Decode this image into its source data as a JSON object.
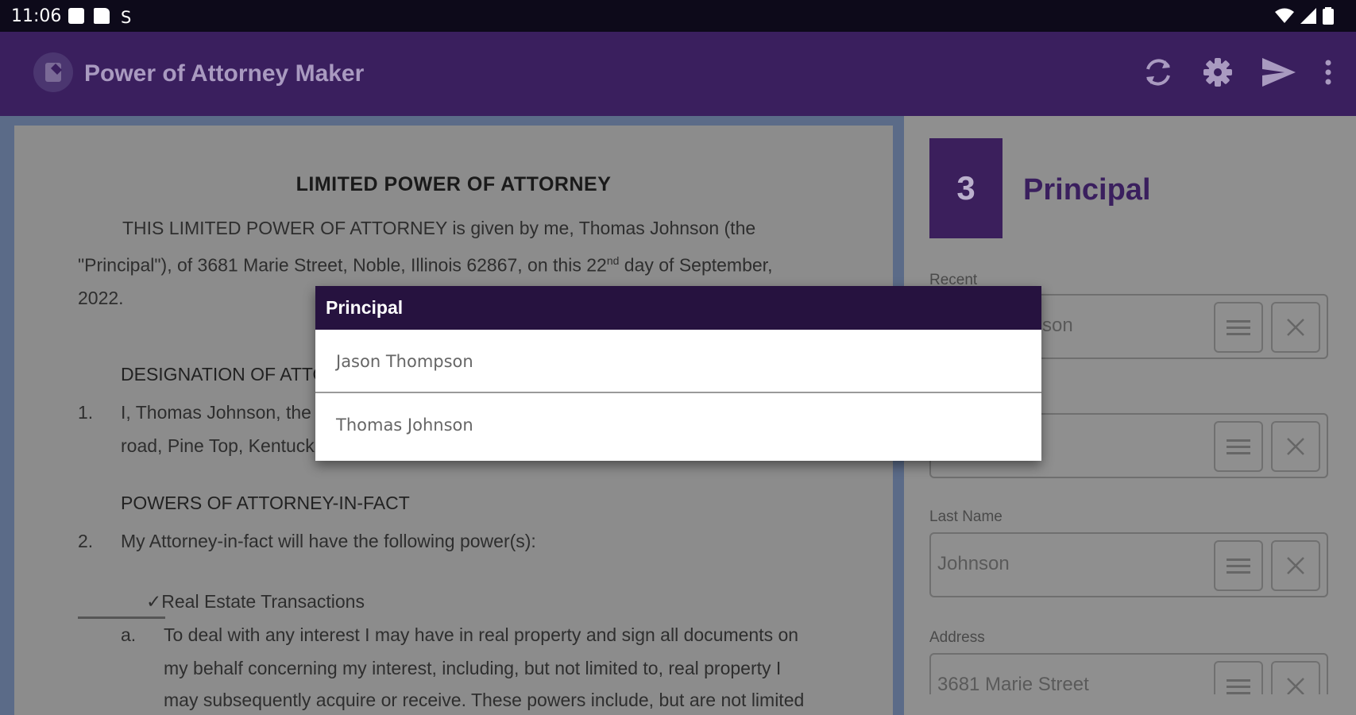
{
  "status_bar": {
    "time": "11:06"
  },
  "app_bar": {
    "title": "Power of Attorney Maker",
    "actions": [
      "sync-icon",
      "gear-icon",
      "send-icon",
      "more-vert-icon"
    ]
  },
  "document": {
    "title": "LIMITED POWER OF ATTORNEY",
    "intro_line1": "THIS LIMITED POWER OF ATTORNEY is given by me, Thomas Johnson (the",
    "intro_line2_a": "\"Principal\"), of 3681 Marie Street, Noble, Illinois 62867, on this 22",
    "intro_line2_sup": "nd",
    "intro_line2_b": " day of September,",
    "intro_line3": "2022.",
    "section1_heading": "DESIGNATION OF ATTO",
    "item1_num": "1.",
    "item1_line1": "I, Thomas Johnson, the",
    "item1_line2": "road, Pine Top, Kentuck",
    "section2_heading": "POWERS OF ATTORNEY-IN-FACT",
    "item2_num": "2.",
    "item2_text": "My Attorney-in-fact will have the following power(s):",
    "check_label": "✓Real Estate Transactions",
    "sub_a_label": "a.",
    "sub_a_line1": "To deal with any interest I may have in real property and sign all documents on",
    "sub_a_line2": "my behalf concerning my interest, including, but not limited to, real property I",
    "sub_a_line3": "may subsequently acquire or receive. These powers include, but are not limited"
  },
  "form": {
    "step_number": "3",
    "step_title": "Principal",
    "fields": [
      {
        "label": "Recent",
        "value": "son"
      },
      {
        "label": "",
        "value": ""
      },
      {
        "label": "Last Name",
        "value": "Johnson"
      },
      {
        "label": "Address",
        "value": "3681 Marie Street"
      }
    ]
  },
  "dialog": {
    "title": "Principal",
    "options": [
      "Jason Thompson",
      "Thomas Johnson"
    ]
  },
  "colors": {
    "app_bar": "#3a1f5e",
    "dialog_header": "#26123f",
    "status_bar": "#0d0a1a"
  }
}
